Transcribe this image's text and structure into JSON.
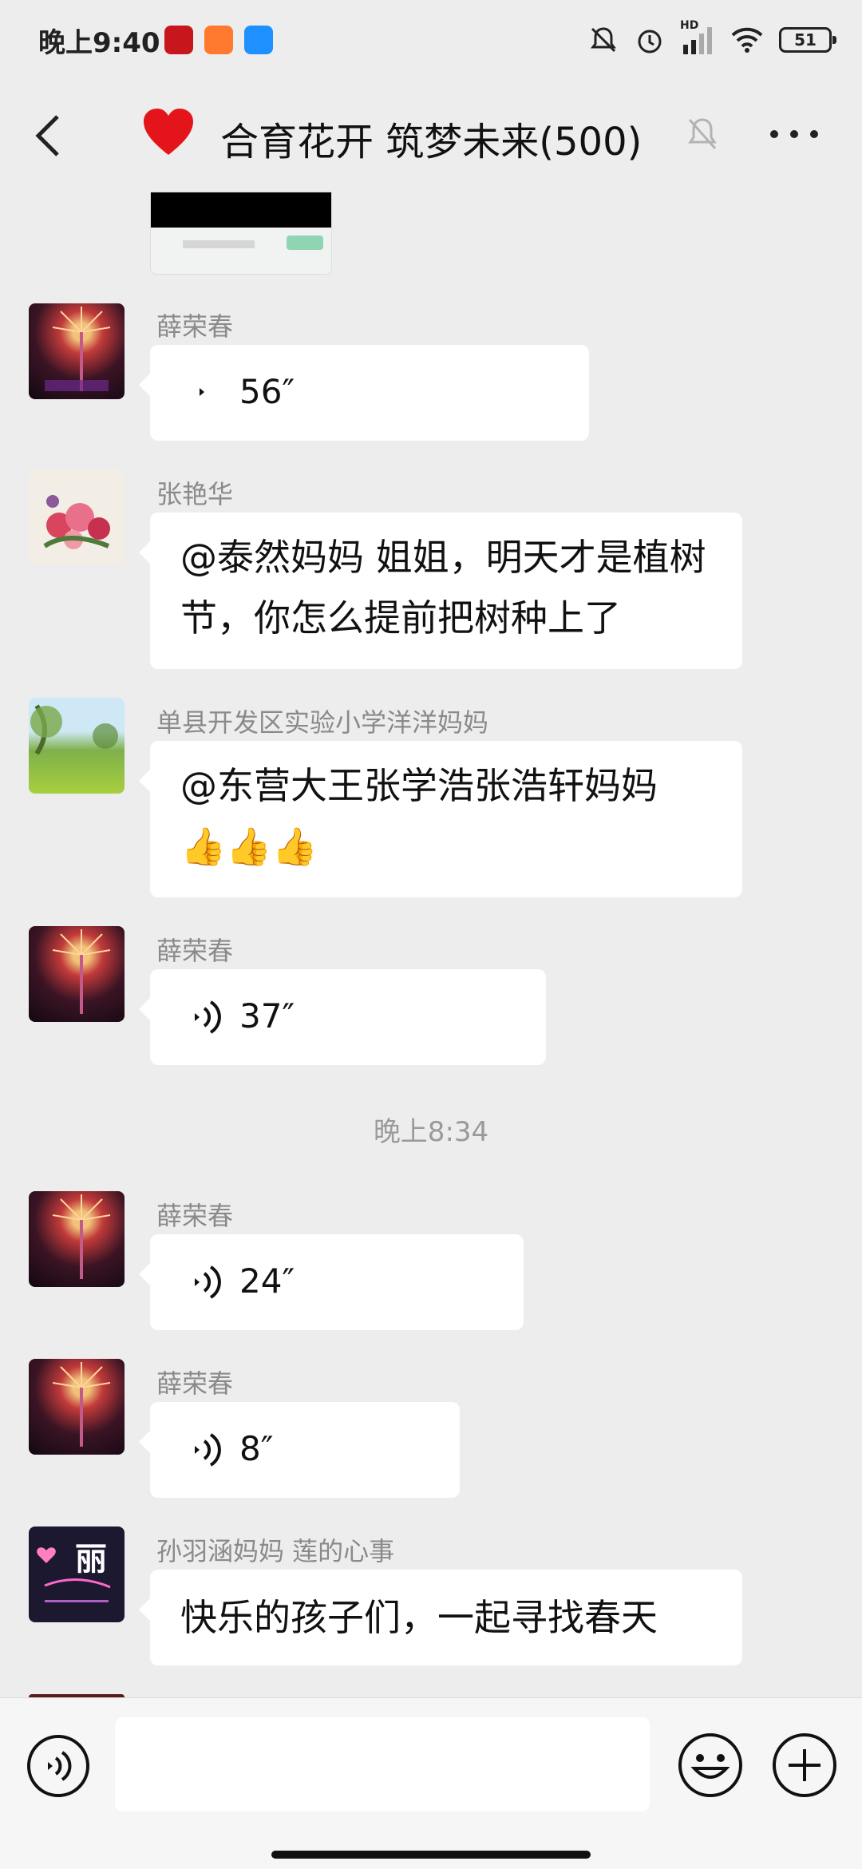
{
  "status_bar": {
    "time": "晚上9:40",
    "network_label": "HD",
    "battery": "51"
  },
  "header": {
    "title": "合育花开 筑梦未来(500)"
  },
  "messages": [
    {
      "sender": "薛荣春",
      "type": "voice",
      "duration": "56″"
    },
    {
      "sender": "张艳华",
      "type": "text",
      "text": "@泰然妈妈  姐姐，明天才是植树节，你怎么提前把树种上了"
    },
    {
      "sender": "单县开发区实验小学洋洋妈妈",
      "type": "text",
      "text": "@东营大王张学浩张浩轩妈妈",
      "emojis": "👍👍👍"
    },
    {
      "sender": "薛荣春",
      "type": "voice",
      "duration": "37″"
    },
    {
      "sender": "薛荣春",
      "type": "voice",
      "duration": "24″"
    },
    {
      "sender": "薛荣春",
      "type": "voice",
      "duration": "8″"
    },
    {
      "sender": "孙羽涵妈妈  莲的心事",
      "type": "text",
      "text": "快乐的孩子们，一起寻找春天"
    }
  ],
  "time_divider": "晚上8:34",
  "avatar_lotus_text": "丽",
  "input": {
    "value": "",
    "placeholder": ""
  },
  "colors": {
    "background": "#ededed",
    "bubble": "#ffffff",
    "heart": "#e4141b",
    "sender": "#8a8a8a"
  },
  "icons": [
    "back-arrow-icon",
    "heart-icon",
    "mute-bell-icon",
    "more-dots-icon",
    "voice-icon",
    "emoji-icon",
    "plus-icon"
  ]
}
